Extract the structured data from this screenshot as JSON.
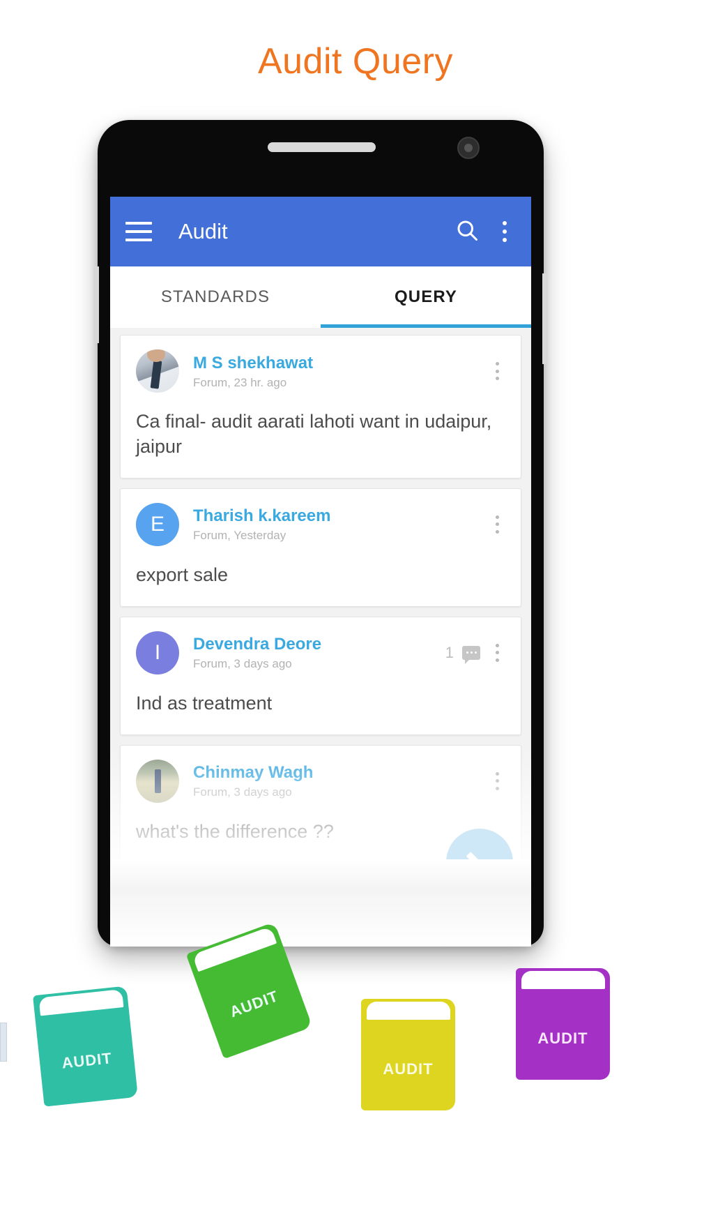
{
  "headline": "Audit Query",
  "headline_color": "#ef7521",
  "phone": {
    "frame_color": "#0a0a0a",
    "speaker_name": "earpiece-speaker",
    "camera_name": "front-camera"
  },
  "appbar": {
    "title": "Audit",
    "background": "#4270d8",
    "menu_icon": "hamburger-menu-icon",
    "search_icon": "search-icon",
    "overflow_icon": "overflow-menu-icon"
  },
  "tabs": [
    {
      "label": "STANDARDS",
      "active": false
    },
    {
      "label": "QUERY",
      "active": true
    }
  ],
  "tab_indicator_color": "#32a3d8",
  "posts": [
    {
      "author": "M S shekhawat",
      "sub": "Forum, 23 hr. ago",
      "body": "Ca final- audit aarati lahoti want in udaipur, jaipur",
      "avatar_type": "photo",
      "avatar_initial": "",
      "comment_count": "",
      "overflow_icon": "overflow-menu-icon"
    },
    {
      "author": "Tharish k.kareem",
      "sub": "Forum, Yesterday",
      "body": "export sale",
      "avatar_type": "initial",
      "avatar_initial": "E",
      "avatar_color": "#57a3ef",
      "comment_count": "",
      "overflow_icon": "overflow-menu-icon"
    },
    {
      "author": "Devendra Deore",
      "sub": "Forum, 3 days ago",
      "body": "Ind as treatment",
      "avatar_type": "initial",
      "avatar_initial": "I",
      "avatar_color": "#7a7ede",
      "comment_count": "1",
      "comment_icon": "comment-bubble-icon",
      "overflow_icon": "overflow-menu-icon"
    },
    {
      "author": "Chinmay Wagh",
      "sub": "Forum, 3 days ago",
      "body": "what's the difference ??",
      "avatar_type": "photo",
      "avatar_initial": "",
      "comment_count": "",
      "overflow_icon": "overflow-menu-icon"
    }
  ],
  "fab": {
    "icon": "pencil-edit-icon",
    "color": "#cfe8f8"
  },
  "books": [
    {
      "label": "AUDIT",
      "color": "#2fbfa4",
      "name": "book-teal"
    },
    {
      "label": "AUDIT",
      "color": "#45bb34",
      "name": "book-green"
    },
    {
      "label": "AUDIT",
      "color": "#ded520",
      "name": "book-yellow"
    },
    {
      "label": "AUDIT",
      "color": "#a530c6",
      "name": "book-purple"
    }
  ]
}
